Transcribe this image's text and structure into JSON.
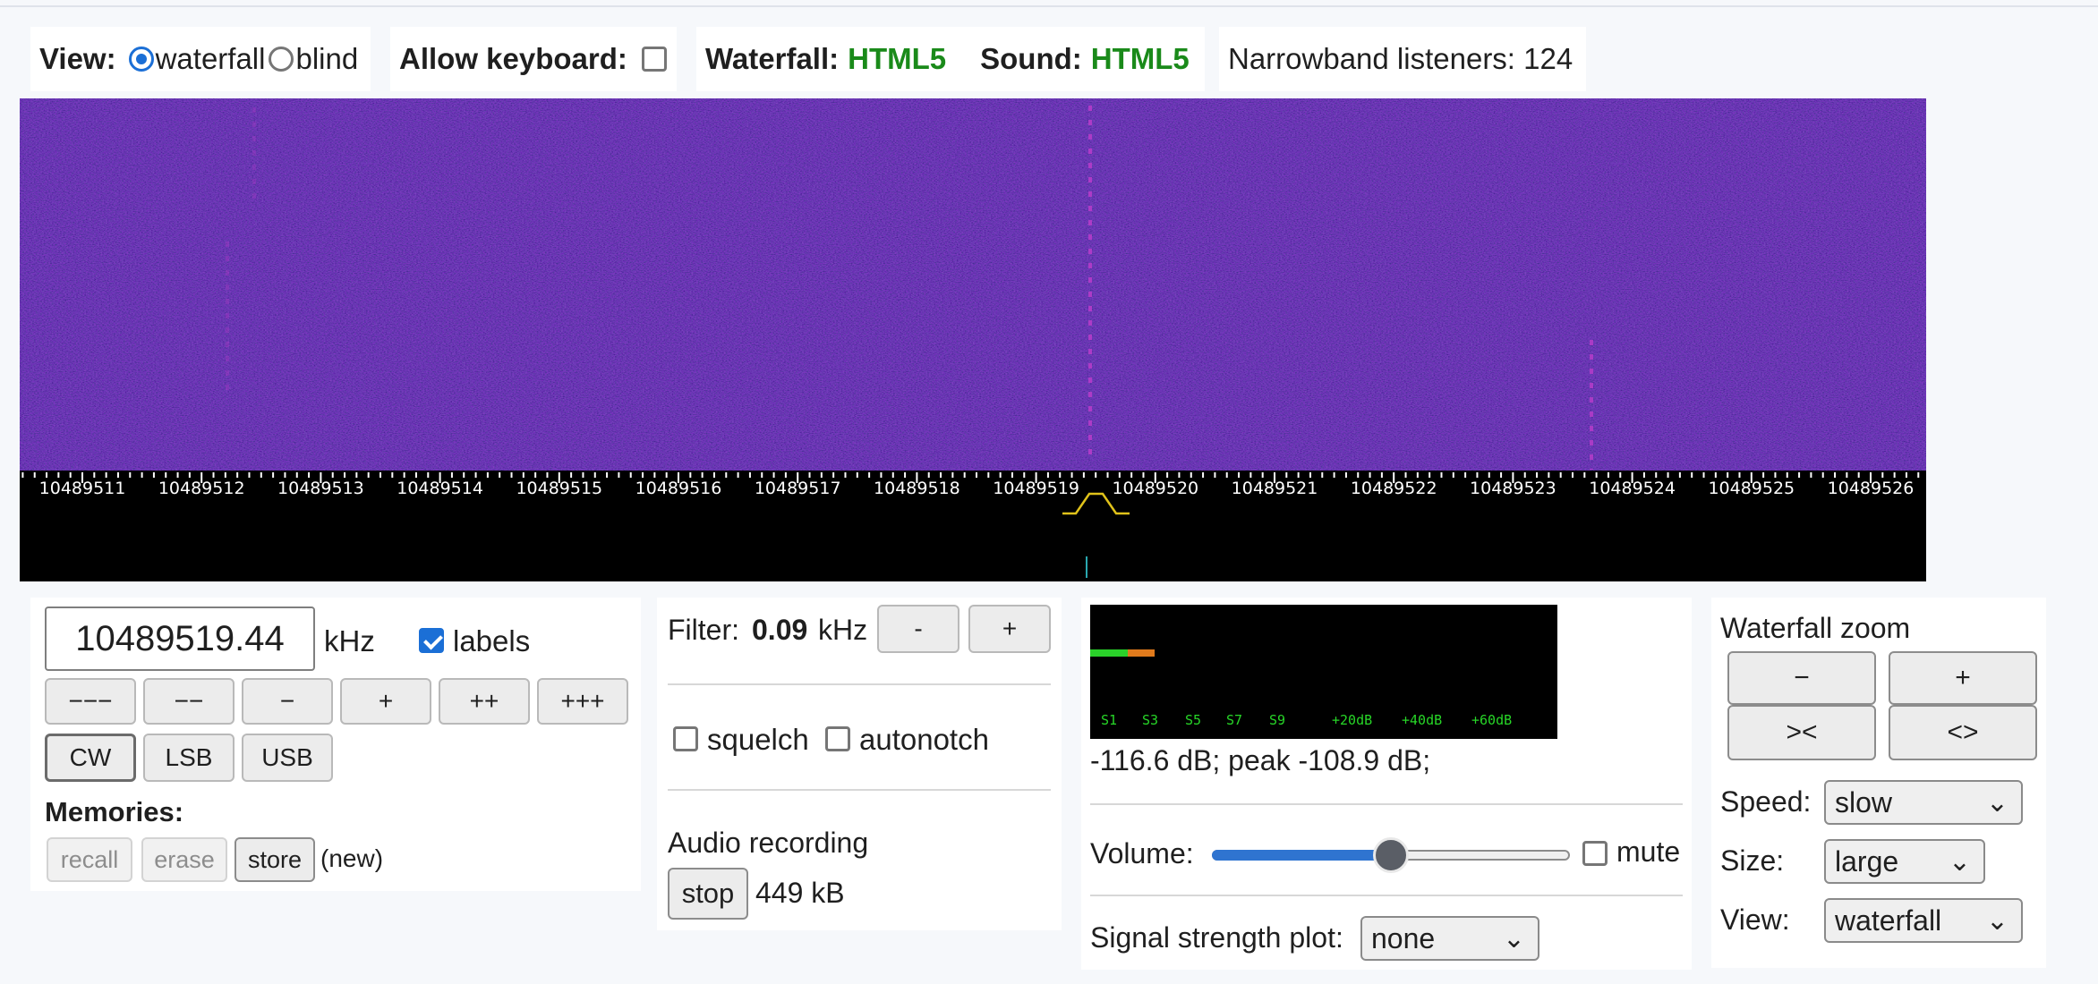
{
  "view": {
    "label": "View:",
    "option_waterfall": "waterfall",
    "option_blind": "blind"
  },
  "keyboard": {
    "label": "Allow keyboard:"
  },
  "status": {
    "waterfall_label": "Waterfall:",
    "waterfall_value": "HTML5",
    "sound_label": "Sound:",
    "sound_value": "HTML5",
    "listeners": "Narrowband listeners: 124"
  },
  "waterfall": {
    "freq_labels": [
      "10489511",
      "10489512",
      "10489513",
      "10489514",
      "10489515",
      "10489516",
      "10489517",
      "10489518",
      "10489519",
      "10489520",
      "10489521",
      "10489522",
      "10489523",
      "10489524",
      "10489525",
      "10489526"
    ],
    "colors": {
      "background": "#1c0d6e",
      "signal": "#b13cc8",
      "marker": "#e0c21a",
      "scale_bg": "#000000"
    }
  },
  "tuning": {
    "frequency": "10489519.44",
    "unit": "kHz",
    "labels": "labels",
    "steps": [
      "−−−",
      "−−",
      "−",
      "+",
      "++",
      "+++"
    ],
    "modes": [
      "CW",
      "LSB",
      "USB"
    ],
    "memories_title": "Memories:",
    "recall": "recall",
    "erase": "erase",
    "store": "store",
    "new": "(new)"
  },
  "filter": {
    "label": "Filter:",
    "value": "0.09",
    "unit": "kHz",
    "minus": "-",
    "plus": "+",
    "squelch": "squelch",
    "autonotch": "autonotch",
    "recording_title": "Audio recording",
    "stop": "stop",
    "size": "449 kB"
  },
  "meter": {
    "scale": [
      "S1",
      "S3",
      "S5",
      "S7",
      "S9",
      "+20dB",
      "+40dB",
      "+60dB"
    ],
    "reading": "-116.6 dB; peak -108.9 dB;",
    "volume_label": "Volume:",
    "volume_level": 0.5,
    "mute": "mute",
    "plot_label": "Signal strength plot:",
    "plot_value": "none"
  },
  "zoom": {
    "title": "Waterfall zoom",
    "minus": "−",
    "plus": "+",
    "narrow": "><",
    "wide": "<>",
    "speed_label": "Speed:",
    "speed_value": "slow",
    "size_label": "Size:",
    "size_value": "large",
    "view_label": "View:",
    "view_value": "waterfall"
  }
}
